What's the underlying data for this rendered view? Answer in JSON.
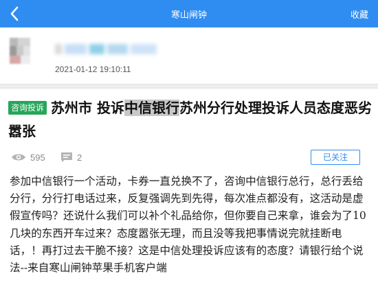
{
  "header": {
    "back_icon": "chevron-left-icon",
    "title": "寒山闸钟",
    "collect_label": "收藏",
    "bar_color": "#2f8cf0"
  },
  "author": {
    "post_time": "2021-01-12 19:10:11"
  },
  "post": {
    "tag": "咨询投诉",
    "tag_color": "#26a65b",
    "title_before": "苏州市 投诉",
    "title_highlight": "中信银行",
    "title_after": "苏州分行处理投诉人员态度恶劣嚣张",
    "views": "595",
    "comments": "2",
    "follow_label": "已关注",
    "content": "参加中信银行一个活动，卡券一直兑换不了，咨询中信银行总行，总行丢给分行，分行打电话过来，反复强调先到先得，每次准点都没有，这活动是虚假宣传吗？还说什么我们可以补个礼品给你，但你要自己来拿，谁会为了10几块的东西开车过来？态度嚣张无理，而且没等我把事情说完就挂断电话，！再打过去干脆不接？这是中信处理投诉应该有的态度？请银行给个说法--来自寒山闸钟苹果手机客户端"
  }
}
